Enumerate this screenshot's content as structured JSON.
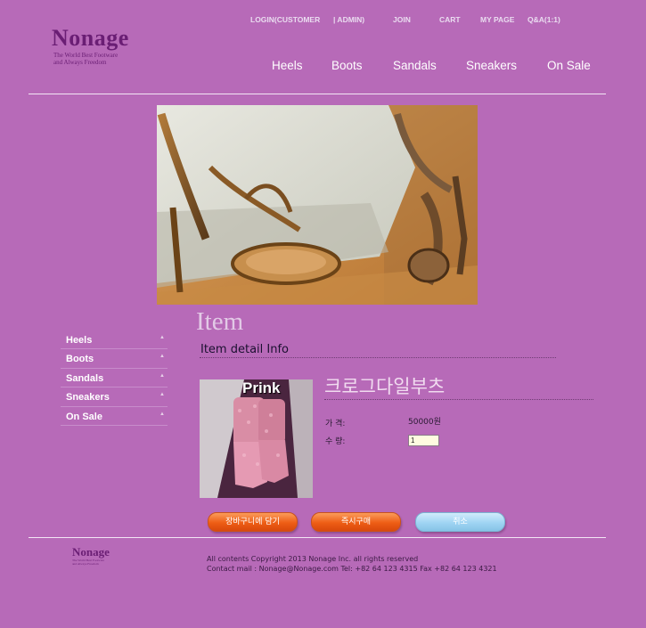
{
  "brand": {
    "name": "Nonage",
    "tagline_line1": "The World Best Footware",
    "tagline_line2": "and Always Freedom"
  },
  "top_links": [
    {
      "label": "LOGIN(CUSTOMER"
    },
    {
      "label": "| ADMIN)"
    },
    {
      "label": "JOIN"
    },
    {
      "label": "CART"
    },
    {
      "label": "MY PAGE"
    },
    {
      "label": "Q&A(1:1)"
    }
  ],
  "nav": [
    {
      "label": "Heels"
    },
    {
      "label": "Boots"
    },
    {
      "label": "Sandals"
    },
    {
      "label": "Sneakers"
    },
    {
      "label": "On Sale"
    }
  ],
  "sidebar": [
    {
      "label": "Heels"
    },
    {
      "label": "Boots"
    },
    {
      "label": "Sandals"
    },
    {
      "label": "Sneakers"
    },
    {
      "label": "On Sale"
    }
  ],
  "main": {
    "heading": "Item",
    "subheading": "Item detail Info"
  },
  "product": {
    "image_caption": "Prink",
    "name": "크로그다일부츠",
    "price_label": "가 격:",
    "price_value": "50000원",
    "qty_label": "수 량:",
    "qty_value": "1"
  },
  "buttons": {
    "add_to_cart": "장바구니에 담기",
    "buy_now": "즉시구매",
    "cancel": "취소"
  },
  "footer": {
    "brand": "Nonage",
    "tagline_line1": "The World Best Footware",
    "tagline_line2": "and Always Freedom",
    "copyright": "All contents Copyright 2013 Nonage Inc. all rights reserved",
    "contact": "Contact mail : Nonage@Nonage.com Tel: +82 64 123 4315 Fax +82 64 123 4321"
  }
}
